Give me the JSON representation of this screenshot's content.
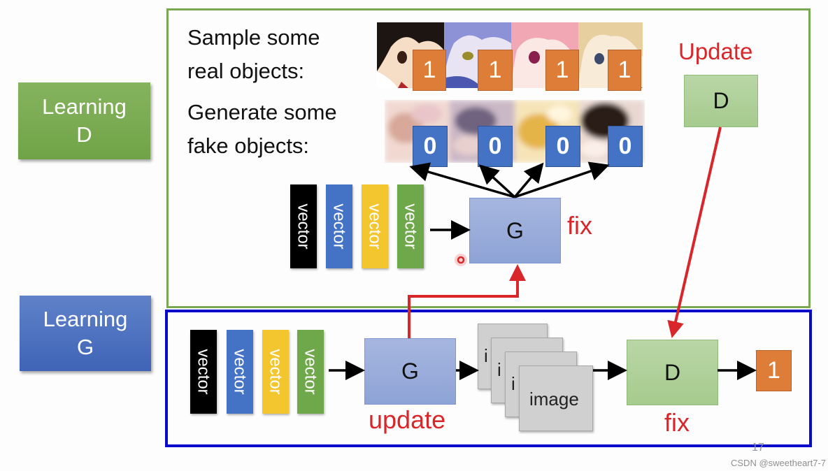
{
  "side_labels": {
    "learning_d": {
      "line1": "Learning",
      "line2": "D",
      "color": "#70a347"
    },
    "learning_g": {
      "line1": "Learning",
      "line2": "G",
      "color": "#4068b8"
    }
  },
  "top_panel": {
    "real_prompt": {
      "line1": "Sample some",
      "line2": "real objects:"
    },
    "fake_prompt": {
      "line1": "Generate some",
      "line2": "fake objects:"
    },
    "real_images": [
      {
        "desc": "anime girl, dark hair",
        "label": "1"
      },
      {
        "desc": "anime girl, lavender hair",
        "label": "1"
      },
      {
        "desc": "anime girl, pink hair",
        "label": "1"
      },
      {
        "desc": "anime girl, blonde hair",
        "label": "1"
      }
    ],
    "fake_images": [
      {
        "desc": "blurry generated face, pale",
        "label": "0"
      },
      {
        "desc": "blurry generated face, purple",
        "label": "0"
      },
      {
        "desc": "blurry generated face, yellow",
        "label": "0"
      },
      {
        "desc": "blurry generated face, dark",
        "label": "0"
      }
    ],
    "vectors": [
      "vector",
      "vector",
      "vector",
      "vector"
    ],
    "generator_label": "G",
    "generator_state": "fix",
    "discriminator_heading": "Update",
    "discriminator_label": "D"
  },
  "bottom_panel": {
    "vectors": [
      "vector",
      "vector",
      "vector",
      "vector"
    ],
    "generator_label": "G",
    "generator_state": "update",
    "stack_labels": [
      "i",
      "i",
      "i",
      "image"
    ],
    "discriminator_label": "D",
    "discriminator_state": "fix",
    "output_label": "1"
  },
  "footer": {
    "page_number": "17",
    "watermark": "CSDN @sweetheart7-7"
  },
  "colors": {
    "frame_d": "#79a752",
    "frame_g": "#0a0acc",
    "red": "#d8262a",
    "real_badge": "#dd7d38",
    "fake_badge": "#4472c4"
  }
}
